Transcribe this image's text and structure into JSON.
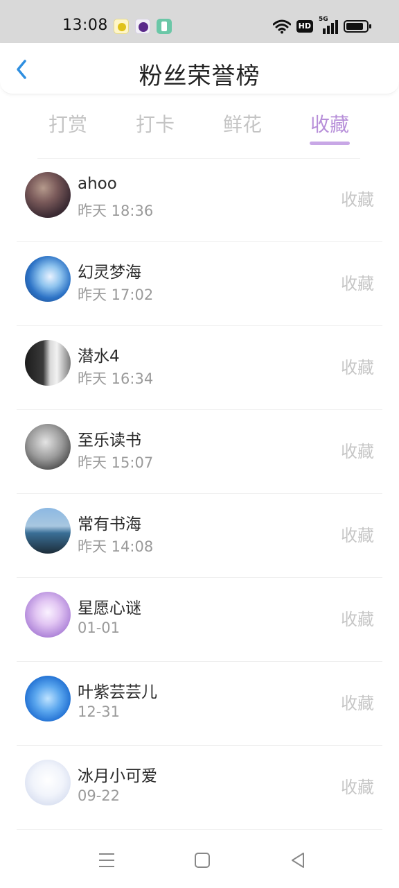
{
  "status_bar": {
    "time": "13:08",
    "network_label": "5G",
    "hd_label": "HD",
    "notification_icons": [
      "yellow-app-icon",
      "purple-app-icon",
      "green-app-icon"
    ],
    "system_icons": [
      "wifi-icon",
      "hd-icon",
      "signal-icon",
      "battery-icon"
    ]
  },
  "header": {
    "title": "粉丝荣誉榜",
    "back_icon": "chevron-left-icon"
  },
  "tabs": [
    {
      "label": "打赏",
      "active": false
    },
    {
      "label": "打卡",
      "active": false
    },
    {
      "label": "鲜花",
      "active": false
    },
    {
      "label": "收藏",
      "active": true
    }
  ],
  "fans": [
    {
      "name": "ahoo",
      "time": "昨天 18:36",
      "action": "收藏"
    },
    {
      "name": "幻灵梦海",
      "time": "昨天 17:02",
      "action": "收藏"
    },
    {
      "name": "潜水4",
      "time": "昨天 16:34",
      "action": "收藏"
    },
    {
      "name": "至乐读书",
      "time": "昨天 15:07",
      "action": "收藏"
    },
    {
      "name": "常有书海",
      "time": "昨天 14:08",
      "action": "收藏"
    },
    {
      "name": "星愿心谜",
      "time": "01-01",
      "action": "收藏"
    },
    {
      "name": "叶紫芸芸儿",
      "time": "12-31",
      "action": "收藏"
    },
    {
      "name": "冰月小可爱",
      "time": "09-22",
      "action": "收藏"
    }
  ],
  "nav_bar": {
    "buttons": [
      "menu-icon",
      "home-square-icon",
      "back-triangle-icon"
    ]
  },
  "colors": {
    "accent": "#b78fd9",
    "tab_indicator": "#c8a7e6",
    "back_arrow": "#2f8fe0",
    "inactive_text": "#c4c4c4",
    "status_bar_bg": "#d9d9d9"
  }
}
